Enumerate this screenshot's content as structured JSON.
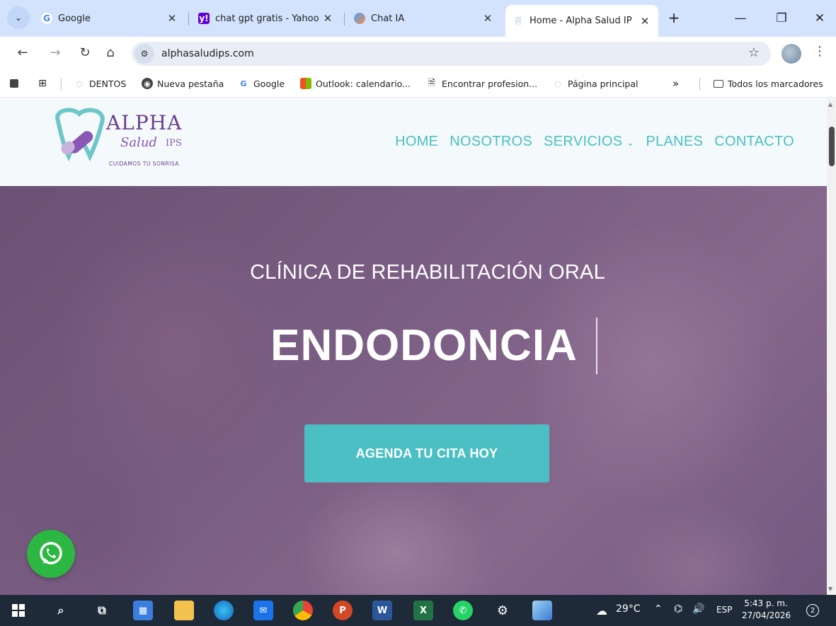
{
  "browser": {
    "tabs": [
      {
        "title": "Google",
        "favicon": "google-icon",
        "active": false
      },
      {
        "title": "chat gpt gratis - Yahoo",
        "favicon": "yahoo-icon",
        "active": false
      },
      {
        "title": "Chat IA",
        "favicon": "chat-ia-icon",
        "active": false
      },
      {
        "title": "Home - Alpha Salud IP",
        "favicon": "tooth-icon",
        "active": true
      }
    ],
    "new_tab_glyph": "+",
    "url": "alphasaludips.com",
    "bookmarks": [
      {
        "label": "DENTOS"
      },
      {
        "label": "Nueva pestaña"
      },
      {
        "label": "Google"
      },
      {
        "label": "Outlook: calendario..."
      },
      {
        "label": "Encontrar profesion..."
      },
      {
        "label": "Página principal"
      }
    ],
    "bookmarks_overflow": "»",
    "all_bookmarks": "Todos los marcadores"
  },
  "site": {
    "logo": {
      "word1": "ALPHA",
      "word2": "Salud",
      "word3": "IPS",
      "tagline": "CUIDAMOS TU SONRISA"
    },
    "nav": [
      "HOME",
      "NOSOTROS",
      "SERVICIOS",
      "PLANES",
      "CONTACTO"
    ],
    "nav_dropdown_glyph": "⌄",
    "hero": {
      "subtitle": "CLÍNICA DE REHABILITACIÓN ORAL",
      "title": "ENDODONCIA",
      "cta": "AGENDA TU CITA HOY"
    }
  },
  "taskbar": {
    "weather": "29°C",
    "language": "ESP",
    "time": "5:43 p. m.",
    "date": "27/04/2026",
    "notifications": "2"
  },
  "colors": {
    "accent_teal": "#4bbfc3",
    "brand_purple": "#6a3f8e",
    "whatsapp_green": "#2bb741",
    "chrome_frame": "#d3e3fd",
    "taskbar": "#1f2a38"
  }
}
